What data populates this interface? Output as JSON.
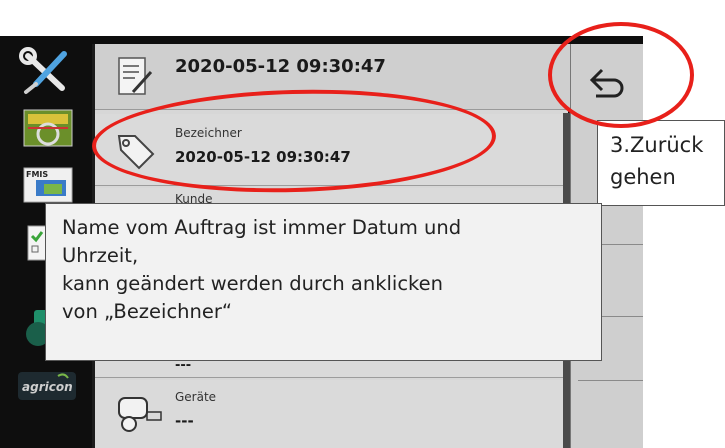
{
  "header": {
    "title": "2020-05-12 09:30:47",
    "back_label": "back"
  },
  "rows": [
    {
      "label": "Bezeichner",
      "value": "2020-05-12 09:30:47"
    },
    {
      "label": "Kunde",
      "value": ""
    },
    {
      "label": "",
      "value": "---"
    },
    {
      "label": "Geräte",
      "value": "---"
    }
  ],
  "sidebar": {
    "items": [
      {
        "name": "tools",
        "icon": "wrench-screwdriver-icon"
      },
      {
        "name": "field-map",
        "icon": "field-map-icon"
      },
      {
        "name": "fmis",
        "icon": "fmis-icon",
        "text": "FMIS"
      },
      {
        "name": "checklist",
        "icon": "checklist-icon"
      },
      {
        "name": "tractor",
        "icon": "tractor-icon"
      },
      {
        "name": "agricon",
        "icon": "agricon-logo-icon",
        "text": "agricon"
      }
    ]
  },
  "annotations": {
    "note_lines": [
      "Name vom Auftrag ist immer Datum und",
      "Uhrzeit,",
      "kann geändert werden durch anklicken",
      "von „Bezeichner“"
    ],
    "step_lines": [
      "3.Zurück",
      "gehen"
    ],
    "highlight_color": "#e8201a"
  },
  "colors": {
    "screen_bg": "#0e0e0e",
    "panel_bg": "#d7d7d7",
    "accent_red": "#e8201a"
  }
}
